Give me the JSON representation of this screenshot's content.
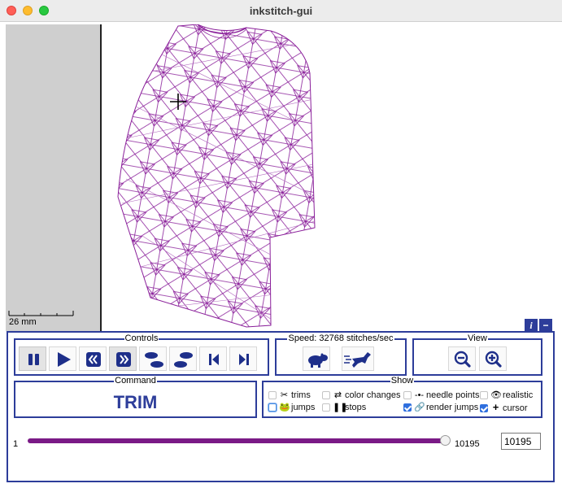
{
  "window": {
    "title": "inkstitch-gui"
  },
  "canvas": {
    "scale_label": "26 mm",
    "stitch_color": "#8a1f9a"
  },
  "panel": {
    "info_icon": "i",
    "collapse_icon": "−"
  },
  "controls": {
    "label": "Controls",
    "buttons": [
      "pause-icon",
      "play-icon",
      "rewind-icon",
      "fast-forward-icon",
      "step-backward-footprints-icon",
      "step-forward-footprints-icon",
      "previous-command-icon",
      "next-command-icon"
    ]
  },
  "speed": {
    "label": "Speed: 32768 stitches/sec"
  },
  "view": {
    "label": "View"
  },
  "command": {
    "label": "Command",
    "value": "TRIM"
  },
  "show": {
    "label": "Show",
    "options": [
      {
        "label": "trims",
        "checked": false
      },
      {
        "label": "color changes",
        "checked": false
      },
      {
        "label": "needle points",
        "checked": false
      },
      {
        "label": "realistic",
        "checked": false
      },
      {
        "label": "jumps",
        "checked": false
      },
      {
        "label": "stops",
        "checked": false
      },
      {
        "label": "render jumps",
        "checked": true
      },
      {
        "label": "cursor",
        "checked": true
      }
    ]
  },
  "slider": {
    "min": "1",
    "max": "10195",
    "value": "10195"
  },
  "colors": {
    "accent": "#2d3d9a",
    "slider": "#7a1a86",
    "checkbox": "#2f6fde"
  }
}
